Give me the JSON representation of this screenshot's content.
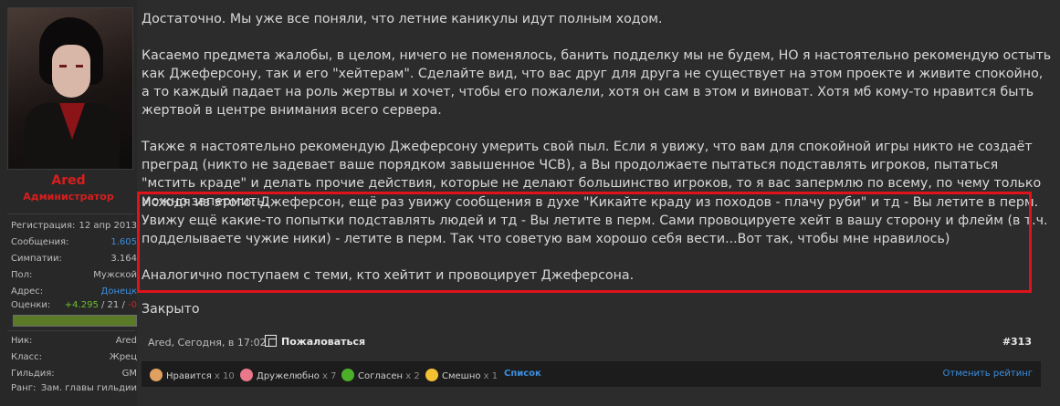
{
  "user": {
    "name": "Ared",
    "title": "Администратор",
    "stats": [
      {
        "label": "Регистрация:",
        "value": "12 апр 2013"
      },
      {
        "label": "Сообщения:",
        "value": "1.605"
      },
      {
        "label": "Симпатии:",
        "value": "3.164"
      },
      {
        "label": "Пол:",
        "value": "Мужской"
      },
      {
        "label": "Адрес:",
        "value": "Донецк"
      }
    ],
    "rating": {
      "label": "Оценки:",
      "positive": "+4.295",
      "sep1": " / ",
      "neutral": "21",
      "sep2": " / ",
      "negative": "-0"
    },
    "reputation_level": 1.0,
    "game_stats": [
      {
        "label": "Ник:",
        "value": "Ared"
      },
      {
        "label": "Класс:",
        "value": "Жрец"
      },
      {
        "label": "Гильдия:",
        "value": "GM"
      },
      {
        "label": "Ранг:",
        "value": "Зам. главы гильдии"
      }
    ]
  },
  "post": {
    "p1": "Достаточно. Мы уже все поняли, что летние каникулы идут полным ходом.",
    "p2": "Касаемо предмета жалобы, в целом, ничего не поменялось, банить подделку мы не будем, НО я настоятельно рекомендую остыть как Джеферсону, так и его \"хейтерам\". Сделайте вид, что вас друг для друга не существует на этом проекте и живите спокойно, а то каждый падает на роль жертвы и хочет, чтобы его пожалели, хотя он сам в этом и виноват. Хотя мб кому-то нравится быть жертвой в центре внимания всего сервера.",
    "p3": "Также я настоятельно рекомендую Джеферсону умерить свой пыл. Если я увижу, что вам для спокойной игры никто не создаёт преград (никто не задевает ваше порядком завышенное ЧСВ), а Вы продолжаете пытаться подставлять игроков, пытаться \"мстить краде\" и делать прочие действия, которые не делают большинство игроков, то я вас запермлю по всему, по чему только можно запермить.",
    "p4": "Исходя из этого: Джеферсон, ещё раз увижу сообщения в духе \"Кикайте краду из походов - плачу руби\" и тд - Вы летите в перм. Увижу ещё какие-то попытки подставлять людей и тд - Вы летите в перм. Сами провоцируете хейт в вашу сторону и флейм (в т.ч. подделываете чужие ники) - летите в перм. Так что советую вам хорошо себя вести...Вот так, чтобы мне нравилось)",
    "p5": "Аналогично поступаем с теми, кто хейтит и провоцирует Джеферсона.",
    "closed": "Закрыто",
    "meta": "Ared, Сегодня, в 17:02",
    "report_label": "Пожаловаться",
    "post_number": "#313"
  },
  "ratings": {
    "items": [
      {
        "label": "Нравится",
        "sep": " x ",
        "count": "10",
        "icon": "thumbs-up-icon",
        "color": "#e0a060"
      },
      {
        "label": "Дружелюбно",
        "sep": " x ",
        "count": "7",
        "icon": "heart-icon",
        "color": "#e8788a"
      },
      {
        "label": "Согласен",
        "sep": " x ",
        "count": "2",
        "icon": "checkmark-icon",
        "color": "#4caf2a"
      },
      {
        "label": "Смешно",
        "sep": " x ",
        "count": "1",
        "icon": "laugh-icon",
        "color": "#f2c233"
      }
    ],
    "list_label": "Список",
    "cancel_label": "Отменить рейтинг"
  }
}
